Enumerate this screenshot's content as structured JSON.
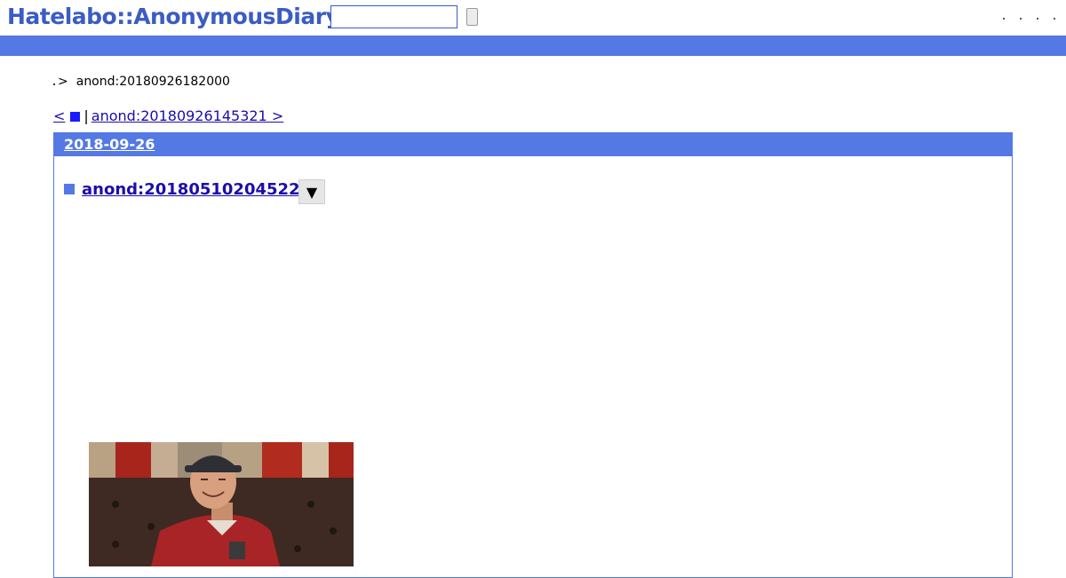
{
  "header": {
    "logo": "Hatelabo::AnonymousDiary",
    "search_value": "",
    "search_button_label": ""
  },
  "breadcrumb": {
    "separator": ">",
    "current": "anond:20180926182000"
  },
  "pager": {
    "prev_label": "<",
    "pipe": "|",
    "next_label": "anond:20180926145321 >"
  },
  "day": {
    "date": "2018-09-26",
    "entry_title": "anond:20180510204522",
    "menu_toggle": "▼"
  },
  "colors": {
    "accent": "#5479e4",
    "logo": "#3b5cc4",
    "link": "#1a0dab"
  }
}
